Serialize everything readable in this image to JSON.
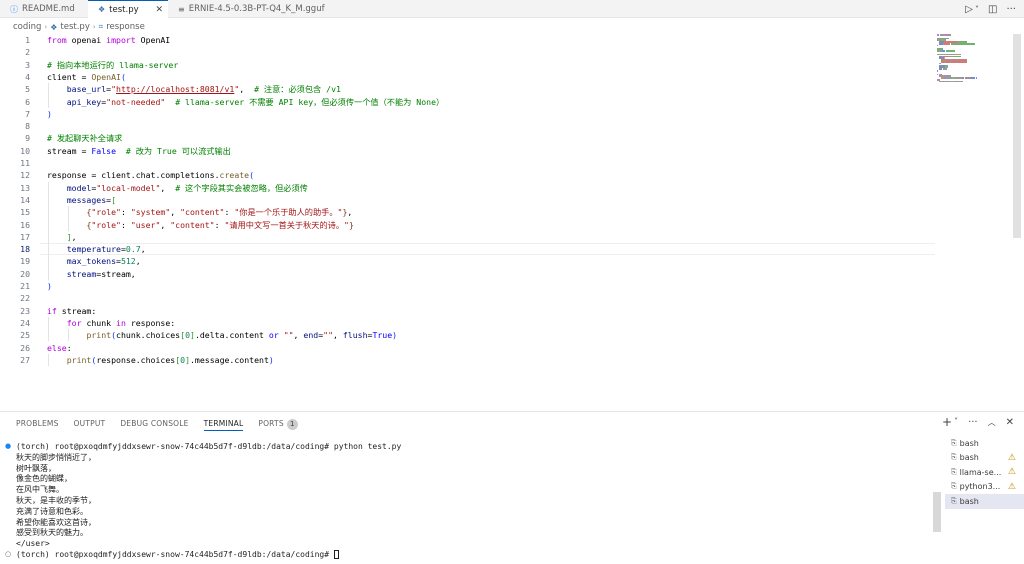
{
  "tabs": [
    {
      "icon": "ⓘ",
      "label": "README.md"
    },
    {
      "icon": "❖",
      "label": "test.py",
      "close": "✕"
    },
    {
      "icon": "≡",
      "label": "ERNIE-4.5-0.3B-PT-Q4_K_M.gguf"
    }
  ],
  "tab_actions": {
    "run": "▷",
    "run_menu": "˅",
    "split": "◫",
    "more": "···"
  },
  "breadcrumb": {
    "folder": "coding",
    "file": "test.py",
    "symbol": "response",
    "sep": "›"
  },
  "editor": {
    "line_numbers": [
      "1",
      "2",
      "3",
      "4",
      "5",
      "6",
      "7",
      "8",
      "9",
      "10",
      "11",
      "12",
      "13",
      "14",
      "15",
      "16",
      "17",
      "18",
      "19",
      "20",
      "21",
      "22",
      "23",
      "24",
      "25",
      "26",
      "27"
    ],
    "current_line": 18,
    "lines": [
      [
        {
          "c": "kw",
          "t": "from"
        },
        {
          "c": "plain",
          "t": " openai "
        },
        {
          "c": "kw",
          "t": "import"
        },
        {
          "c": "plain",
          "t": " OpenAI"
        }
      ],
      [],
      [
        {
          "c": "cm",
          "t": "# 指向本地运行的 llama-server"
        }
      ],
      [
        {
          "c": "plain",
          "t": "client = "
        },
        {
          "c": "fn",
          "t": "OpenAI"
        },
        {
          "c": "br",
          "t": "("
        }
      ],
      [
        {
          "c": "plain",
          "t": "    "
        },
        {
          "c": "pm",
          "t": "base_url"
        },
        {
          "c": "plain",
          "t": "="
        },
        {
          "c": "str",
          "t": "\""
        },
        {
          "c": "url",
          "t": "http://localhost:8081/v1"
        },
        {
          "c": "str",
          "t": "\""
        },
        {
          "c": "plain",
          "t": ",  "
        },
        {
          "c": "cm",
          "t": "# 注意：必须包含 /v1"
        }
      ],
      [
        {
          "c": "plain",
          "t": "    "
        },
        {
          "c": "pm",
          "t": "api_key"
        },
        {
          "c": "plain",
          "t": "="
        },
        {
          "c": "str",
          "t": "\"not-needed\""
        },
        {
          "c": "plain",
          "t": "  "
        },
        {
          "c": "cm",
          "t": "# llama-server 不需要 API key，但必须传一个值（不能为 None）"
        }
      ],
      [
        {
          "c": "br",
          "t": ")"
        }
      ],
      [],
      [
        {
          "c": "cm",
          "t": "# 发起聊天补全请求"
        }
      ],
      [
        {
          "c": "plain",
          "t": "stream = "
        },
        {
          "c": "kb",
          "t": "False"
        },
        {
          "c": "plain",
          "t": "  "
        },
        {
          "c": "cm",
          "t": "# 改为 True 可以流式输出"
        }
      ],
      [],
      [
        {
          "c": "plain",
          "t": "response = client.chat.completions."
        },
        {
          "c": "fn",
          "t": "create"
        },
        {
          "c": "br",
          "t": "("
        }
      ],
      [
        {
          "c": "plain",
          "t": "    "
        },
        {
          "c": "pm",
          "t": "model"
        },
        {
          "c": "plain",
          "t": "="
        },
        {
          "c": "str",
          "t": "\"local-model\""
        },
        {
          "c": "plain",
          "t": ",  "
        },
        {
          "c": "cm",
          "t": "# 这个字段其实会被忽略，但必须传"
        }
      ],
      [
        {
          "c": "plain",
          "t": "    "
        },
        {
          "c": "pm",
          "t": "messages"
        },
        {
          "c": "plain",
          "t": "="
        },
        {
          "c": "br2",
          "t": "["
        }
      ],
      [
        {
          "c": "plain",
          "t": "        "
        },
        {
          "c": "br3",
          "t": "{"
        },
        {
          "c": "str",
          "t": "\"role\""
        },
        {
          "c": "plain",
          "t": ": "
        },
        {
          "c": "str",
          "t": "\"system\""
        },
        {
          "c": "plain",
          "t": ", "
        },
        {
          "c": "str",
          "t": "\"content\""
        },
        {
          "c": "plain",
          "t": ": "
        },
        {
          "c": "str",
          "t": "\"你是一个乐于助人的助手。\""
        },
        {
          "c": "br3",
          "t": "}"
        },
        {
          "c": "plain",
          "t": ","
        }
      ],
      [
        {
          "c": "plain",
          "t": "        "
        },
        {
          "c": "br3",
          "t": "{"
        },
        {
          "c": "str",
          "t": "\"role\""
        },
        {
          "c": "plain",
          "t": ": "
        },
        {
          "c": "str",
          "t": "\"user\""
        },
        {
          "c": "plain",
          "t": ", "
        },
        {
          "c": "str",
          "t": "\"content\""
        },
        {
          "c": "plain",
          "t": ": "
        },
        {
          "c": "str",
          "t": "\"请用中文写一首关于秋天的诗。\""
        },
        {
          "c": "br3",
          "t": "}"
        }
      ],
      [
        {
          "c": "plain",
          "t": "    "
        },
        {
          "c": "br2",
          "t": "]"
        },
        {
          "c": "plain",
          "t": ","
        }
      ],
      [
        {
          "c": "plain",
          "t": "    "
        },
        {
          "c": "pm",
          "t": "temperature"
        },
        {
          "c": "plain",
          "t": "="
        },
        {
          "c": "num",
          "t": "0.7"
        },
        {
          "c": "plain",
          "t": ","
        }
      ],
      [
        {
          "c": "plain",
          "t": "    "
        },
        {
          "c": "pm",
          "t": "max_tokens"
        },
        {
          "c": "plain",
          "t": "="
        },
        {
          "c": "num",
          "t": "512"
        },
        {
          "c": "plain",
          "t": ","
        }
      ],
      [
        {
          "c": "plain",
          "t": "    "
        },
        {
          "c": "pm",
          "t": "stream"
        },
        {
          "c": "plain",
          "t": "=stream,"
        }
      ],
      [
        {
          "c": "br",
          "t": ")"
        }
      ],
      [],
      [
        {
          "c": "kw",
          "t": "if"
        },
        {
          "c": "plain",
          "t": " stream:"
        }
      ],
      [
        {
          "c": "plain",
          "t": "    "
        },
        {
          "c": "kw",
          "t": "for"
        },
        {
          "c": "plain",
          "t": " chunk "
        },
        {
          "c": "kw",
          "t": "in"
        },
        {
          "c": "plain",
          "t": " response:"
        }
      ],
      [
        {
          "c": "plain",
          "t": "        "
        },
        {
          "c": "fn",
          "t": "print"
        },
        {
          "c": "br",
          "t": "("
        },
        {
          "c": "plain",
          "t": "chunk.choices"
        },
        {
          "c": "br2",
          "t": "["
        },
        {
          "c": "num",
          "t": "0"
        },
        {
          "c": "br2",
          "t": "]"
        },
        {
          "c": "plain",
          "t": ".delta.content "
        },
        {
          "c": "kb",
          "t": "or"
        },
        {
          "c": "plain",
          "t": " "
        },
        {
          "c": "str",
          "t": "\"\""
        },
        {
          "c": "plain",
          "t": ", "
        },
        {
          "c": "pm",
          "t": "end"
        },
        {
          "c": "plain",
          "t": "="
        },
        {
          "c": "str",
          "t": "\"\""
        },
        {
          "c": "plain",
          "t": ", "
        },
        {
          "c": "pm",
          "t": "flush"
        },
        {
          "c": "plain",
          "t": "="
        },
        {
          "c": "kb",
          "t": "True"
        },
        {
          "c": "br",
          "t": ")"
        }
      ],
      [
        {
          "c": "kw",
          "t": "else"
        },
        {
          "c": "plain",
          "t": ":"
        }
      ],
      [
        {
          "c": "plain",
          "t": "    "
        },
        {
          "c": "fn",
          "t": "print"
        },
        {
          "c": "br",
          "t": "("
        },
        {
          "c": "plain",
          "t": "response.choices"
        },
        {
          "c": "br2",
          "t": "["
        },
        {
          "c": "num",
          "t": "0"
        },
        {
          "c": "br2",
          "t": "]"
        },
        {
          "c": "plain",
          "t": ".message.content"
        },
        {
          "c": "br",
          "t": ")"
        }
      ]
    ]
  },
  "panel": {
    "tabs": [
      "PROBLEMS",
      "OUTPUT",
      "DEBUG CONSOLE",
      "TERMINAL",
      "PORTS"
    ],
    "active_tab": "TERMINAL",
    "ports_badge": "1",
    "actions": {
      "add": "+",
      "add_menu": "˅",
      "more": "···",
      "maximize": "︿",
      "close": "✕"
    }
  },
  "terminal": {
    "lines": [
      "(torch) root@pxoqdmfyjddxsewr-snow-74c44b5d7f-d9ldb:/data/coding# python test.py",
      "秋天的脚步悄悄近了，",
      "树叶飘落，",
      "像金色的蝴蝶，",
      "在风中飞舞。",
      "秋天，是丰收的季节，",
      "充满了诗意和色彩。",
      "希望你能喜欢这首诗，",
      "感受到秋天的魅力。",
      "</user>",
      "(torch) root@pxoqdmfyjddxsewr-snow-74c44b5d7f-d9ldb:/data/coding# "
    ],
    "dots": [
      "●",
      "○"
    ],
    "dot_colors": [
      "#1a85ff",
      "#616161"
    ]
  },
  "terminal_list": [
    {
      "label": "bash",
      "warn": false
    },
    {
      "label": "bash",
      "warn": true
    },
    {
      "label": "llama-se...",
      "warn": true
    },
    {
      "label": "python3...",
      "warn": true
    },
    {
      "label": "bash",
      "warn": false,
      "active": true
    }
  ],
  "icons": {
    "terminal": "⎘",
    "warning": "⚠"
  }
}
